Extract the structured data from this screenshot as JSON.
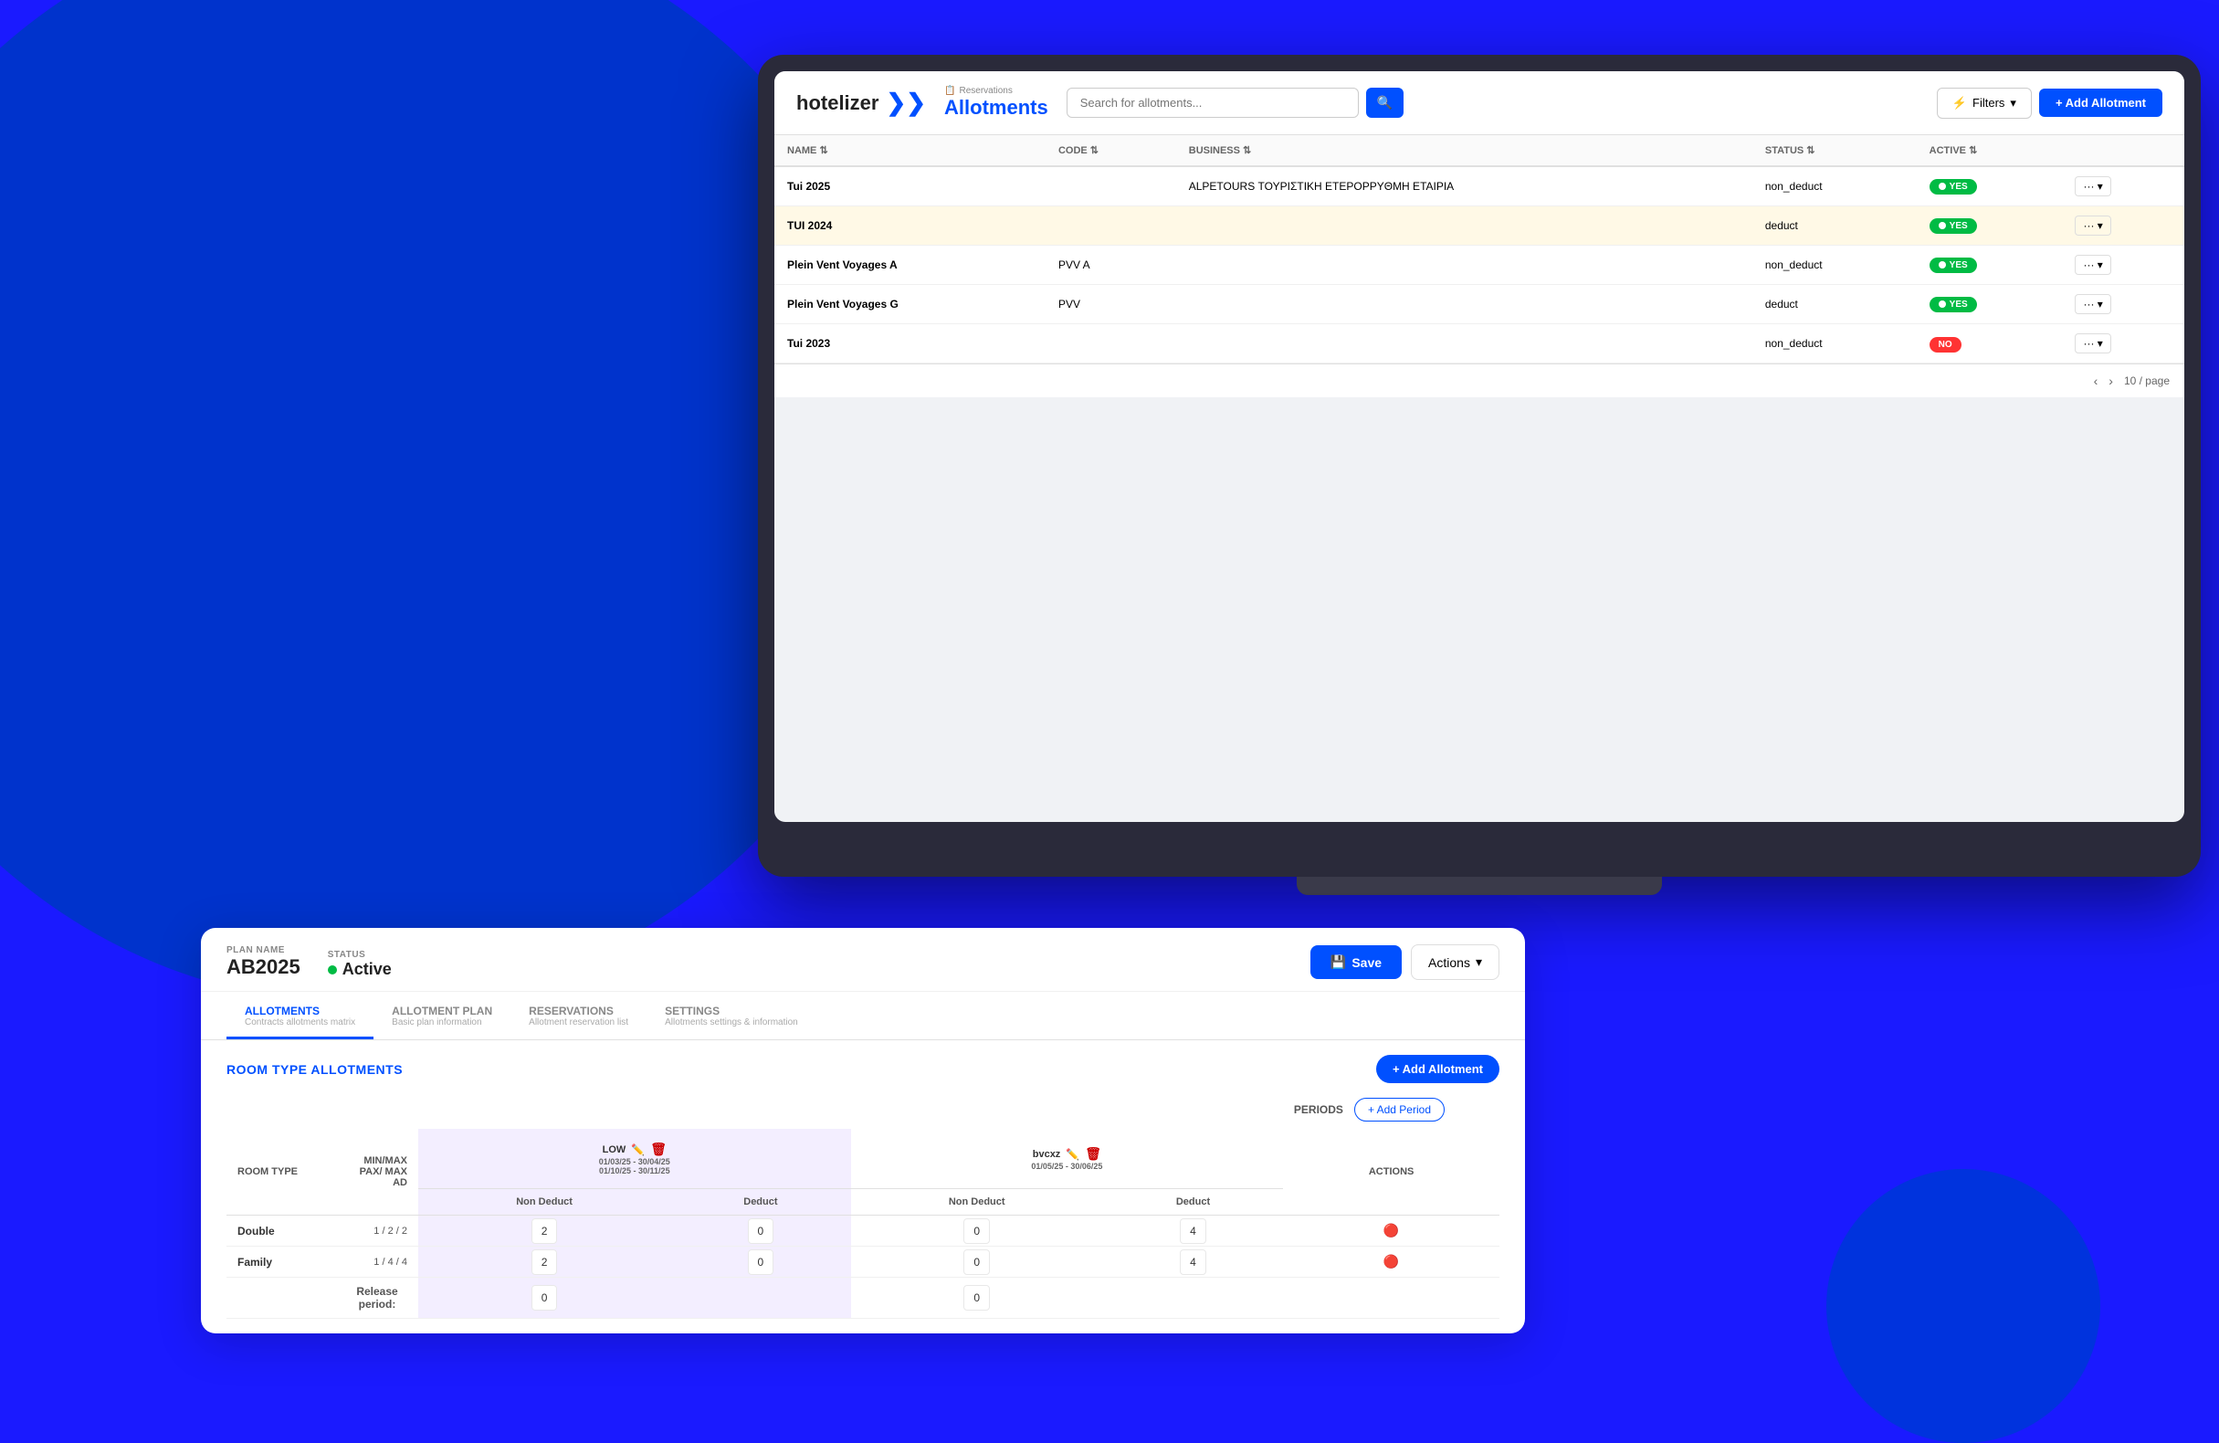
{
  "app": {
    "logo_text": "hotelizer",
    "logo_chevron": "❯",
    "breadcrumb": "Reservations",
    "nav_title": "Allotments",
    "search_placeholder": "Search for allotments...",
    "search_icon": "🔍",
    "filters_label": "Filters",
    "add_allotment_label": "+ Add Allotment"
  },
  "table": {
    "columns": [
      "NAME",
      "CODE",
      "BUSINESS",
      "STATUS",
      "ACTIVE",
      ""
    ],
    "rows": [
      {
        "name": "Tui 2025",
        "code": "",
        "business": "ALPETOURS ΤΟΥΡΙΣΤΙΚΗ ΕΤΕΡΟPPYΘΜΗ ΕΤΑΙΡΙΑ",
        "status": "non_deduct",
        "active": "YES",
        "highlighted": false
      },
      {
        "name": "TUI 2024",
        "code": "",
        "business": "",
        "status": "deduct",
        "active": "YES",
        "highlighted": true
      },
      {
        "name": "Plein Vent Voyages A",
        "code": "PVV A",
        "business": "",
        "status": "non_deduct",
        "active": "YES",
        "highlighted": false
      },
      {
        "name": "Plein Vent Voyages G",
        "code": "PVV",
        "business": "",
        "status": "deduct",
        "active": "YES",
        "highlighted": false
      },
      {
        "name": "Tui 2023",
        "code": "",
        "business": "",
        "status": "non_deduct",
        "active": "NO",
        "highlighted": false
      }
    ],
    "per_page": "10 / page"
  },
  "panel": {
    "plan_label": "PLAN NAME",
    "plan_value": "AB2025",
    "status_label": "STATUS",
    "status_value": "Active",
    "save_label": "Save",
    "actions_label": "Actions",
    "save_icon": "💾"
  },
  "tabs": [
    {
      "id": "allotments",
      "label": "ALLOTMENTS",
      "subtitle": "Contracts allotments matrix",
      "active": true
    },
    {
      "id": "allotment-plan",
      "label": "ALLOTMENT PLAN",
      "subtitle": "Basic plan information",
      "active": false
    },
    {
      "id": "reservations",
      "label": "RESERVATIONS",
      "subtitle": "Allotment reservation list",
      "active": false
    },
    {
      "id": "settings",
      "label": "SETTINGS",
      "subtitle": "Allotments settings & information",
      "active": false
    }
  ],
  "rta": {
    "title": "ROOM TYPE ALLOTMENTS",
    "add_label": "+ Add Allotment",
    "periods_label": "PERIODS",
    "add_period_label": "+ Add Period",
    "columns": {
      "room_type": "ROOM TYPE",
      "min_max": "MIN/MAX PAX/ MAX AD",
      "periods": [
        {
          "name": "LOW",
          "dates1": "01/03/25 - 30/04/25",
          "dates2": "01/10/25 - 30/11/25",
          "has_edit": true,
          "has_delete": true
        },
        {
          "name": "bvcxz",
          "dates1": "01/05/25 - 30/06/25",
          "has_edit": true,
          "has_delete": true
        }
      ],
      "actions": "ACTIONS"
    },
    "subcolumns": [
      "Non Deduct",
      "Deduct",
      "Non Deduct",
      "Deduct"
    ],
    "rows": [
      {
        "room_type": "Double",
        "pax": "1 / 2 / 2",
        "low_non_deduct": "2",
        "low_deduct": "0",
        "bvcxz_non_deduct": "0",
        "bvcxz_deduct": "4"
      },
      {
        "room_type": "Family",
        "pax": "1 / 4 / 4",
        "low_non_deduct": "2",
        "low_deduct": "0",
        "bvcxz_non_deduct": "0",
        "bvcxz_deduct": "4"
      }
    ],
    "release_label": "Release period:",
    "release_low": "0",
    "release_bvcxz": "0"
  }
}
